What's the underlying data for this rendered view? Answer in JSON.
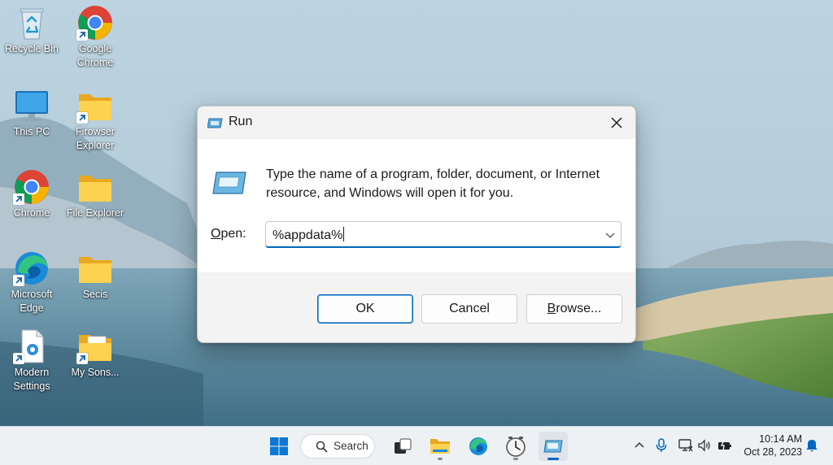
{
  "desktop": {
    "icons": [
      {
        "label": "Recycle Bin"
      },
      {
        "label": "Google Chrome"
      },
      {
        "label": "This PC"
      },
      {
        "label": "Firowser Explorer"
      },
      {
        "label": "Chrome"
      },
      {
        "label": "File Explorer"
      },
      {
        "label": "Microsoft Edge"
      },
      {
        "label": "Secis"
      },
      {
        "label": "Modern Settings"
      },
      {
        "label": "My Sons..."
      }
    ]
  },
  "run_dialog": {
    "title": "Run",
    "description": "Type the name of a program, folder, document, or Internet resource, and Windows will open it for you.",
    "open_label_underlined": "O",
    "open_label_rest": "pen:",
    "open_value": "%appdata%",
    "ok_label": "OK",
    "cancel_label": "Cancel",
    "browse_label_underlined": "B",
    "browse_label_rest": "rowse..."
  },
  "taskbar": {
    "search_label": "Search"
  },
  "tray": {
    "time": "10:14 AM",
    "date": "Oct 28, 2023"
  },
  "colors": {
    "accent": "#0067c0",
    "dialog_body": "#ffffff",
    "dialog_footer": "#f3f3f3",
    "taskbar": "#eef1f4"
  }
}
